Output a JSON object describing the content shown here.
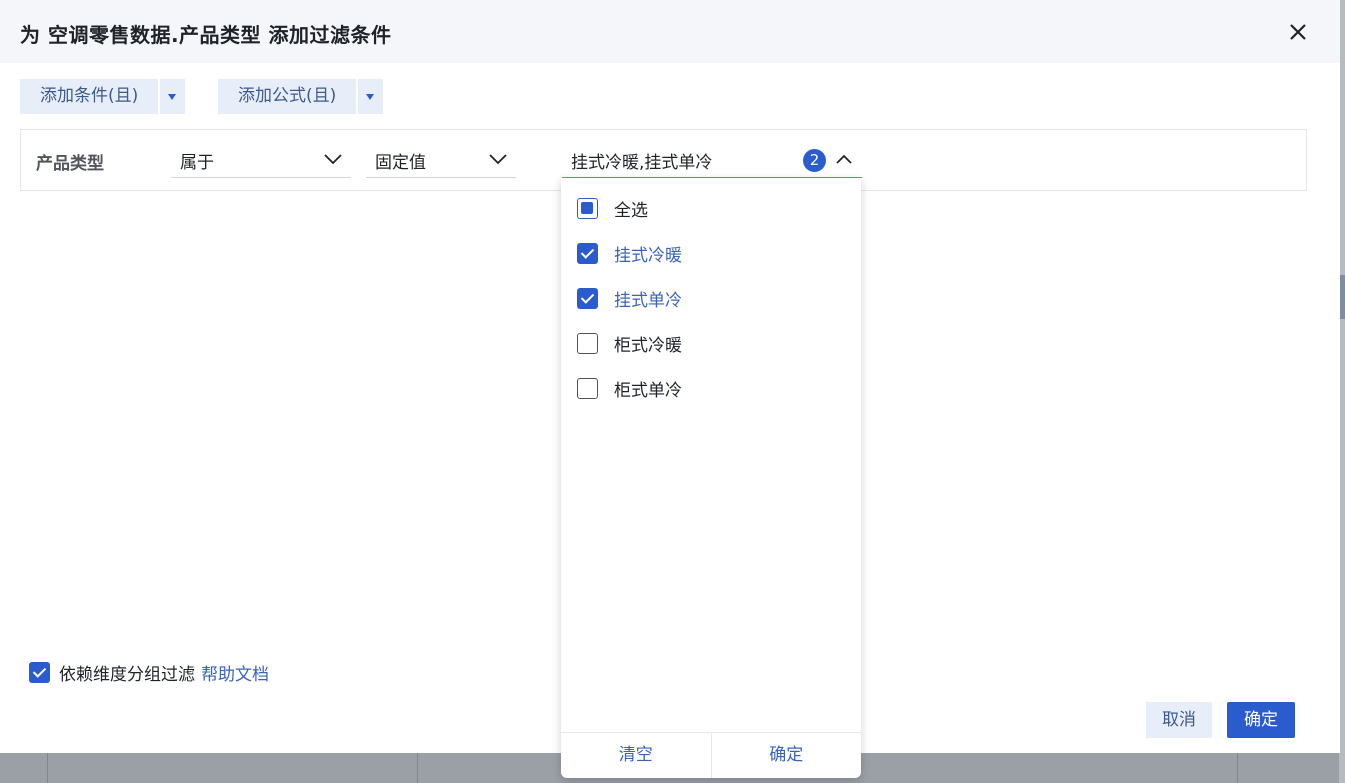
{
  "dialog": {
    "title": "为 空调零售数据.产品类型 添加过滤条件"
  },
  "toolbar": {
    "add_condition_label": "添加条件(且)",
    "add_formula_label": "添加公式(且)"
  },
  "condition": {
    "field_label": "产品类型",
    "operator_value": "属于",
    "value_type": "固定值",
    "selected_values_text": "挂式冷暖,挂式单冷",
    "selected_count": "2"
  },
  "dropdown": {
    "select_all_label": "全选",
    "select_all_state": "partial",
    "options": [
      {
        "label": "挂式冷暖",
        "checked": true
      },
      {
        "label": "挂式单冷",
        "checked": true
      },
      {
        "label": "柜式冷暖",
        "checked": false
      },
      {
        "label": "柜式单冷",
        "checked": false
      }
    ],
    "clear_label": "清空",
    "confirm_label": "确定"
  },
  "footer": {
    "dependency_filter_label": "依赖维度分组过滤",
    "dependency_filter_checked": true,
    "help_link_label": "帮助文档",
    "cancel_label": "取消",
    "ok_label": "确定"
  },
  "icons": {
    "close": "close-icon",
    "dropdown_arrow": "caret-down-icon",
    "chevron_down": "chevron-down-icon",
    "chevron_up": "chevron-up-icon",
    "checkbox": "checkbox-icon"
  },
  "colors": {
    "accent": "#2b5cce",
    "link": "#3a63b8",
    "light_button_bg": "#e8eef9",
    "header_bg": "#f4f6f9",
    "active_underline": "#3cb371"
  }
}
